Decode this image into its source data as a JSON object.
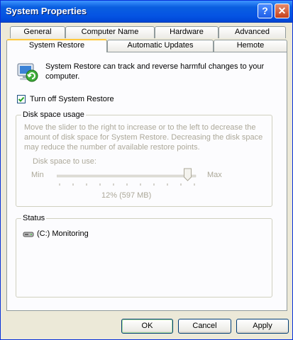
{
  "window": {
    "title": "System Properties",
    "help_glyph": "?",
    "close_glyph": "✕"
  },
  "tabs": {
    "row1": [
      "General",
      "Computer Name",
      "Hardware",
      "Advanced"
    ],
    "row2": [
      "System Restore",
      "Automatic Updates",
      "Hemote"
    ],
    "active": "System Restore"
  },
  "intro": {
    "text": "System Restore can track and reverse harmful changes to your computer."
  },
  "turn_off": {
    "label": "Turn off System Restore",
    "checked": true
  },
  "disk_space": {
    "legend": "Disk space usage",
    "description": "Move the slider to the right to increase or to the left to decrease the amount of disk space for System Restore. Decreasing the disk space may reduce the number of available restore points.",
    "slider_label": "Disk space to use:",
    "min_label": "Min",
    "max_label": "Max",
    "value_text": "12% (597 MB)",
    "slider_fraction": 0.95
  },
  "status": {
    "legend": "Status",
    "drives": [
      {
        "label": "(C:) Monitoring"
      }
    ]
  },
  "buttons": {
    "ok": "OK",
    "cancel": "Cancel",
    "apply": "Apply"
  },
  "colors": {
    "titlebar": "#0554e3",
    "tab_highlight": "#ffc83c",
    "checkbox_check": "#21a121"
  }
}
